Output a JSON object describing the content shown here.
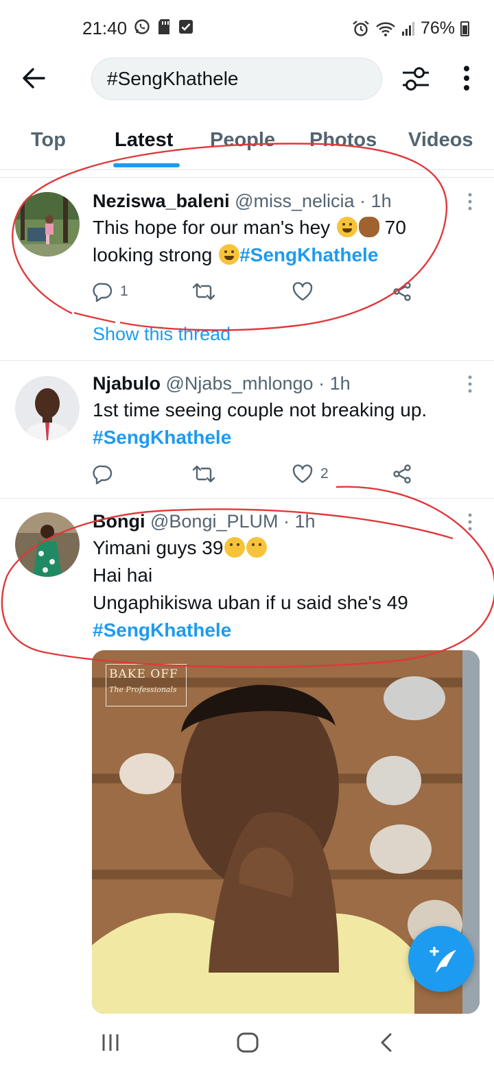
{
  "status_bar": {
    "time": "21:40",
    "battery": "76%",
    "left_icons": [
      "whatsapp-icon",
      "sd-card-icon",
      "check-square-icon"
    ],
    "right_icons": [
      "alarm-icon",
      "wifi-icon",
      "signal-icon",
      "battery-icon"
    ]
  },
  "header": {
    "search_query": "#SengKhathele",
    "back_icon": "arrow-left-icon",
    "filter_icon": "sliders-icon",
    "more_icon": "more-vertical-icon"
  },
  "tabs": [
    {
      "label": "Top",
      "active": false
    },
    {
      "label": "Latest",
      "active": true
    },
    {
      "label": "People",
      "active": false
    },
    {
      "label": "Photos",
      "active": false
    },
    {
      "label": "Videos",
      "active": false
    }
  ],
  "tweets": [
    {
      "name": "Neziswa_baleni",
      "handle": "@miss_nelicia",
      "dot": "·",
      "time": "1h",
      "line1": "This hope for our man's hey ",
      "line1_tail": " 70",
      "line2": "looking strong ",
      "hashtag": "#SengKhathele",
      "reply_count": "1",
      "like_count": "",
      "show_thread": "Show this thread"
    },
    {
      "name": "Njabulo",
      "handle": "@Njabs_mhlongo",
      "dot": "·",
      "time": "1h",
      "line1": "1st time seeing couple not breaking up.",
      "hashtag": "#SengKhathele",
      "reply_count": "",
      "like_count": "2"
    },
    {
      "name": "Bongi",
      "handle": "@Bongi_PLUM",
      "dot": "·",
      "time": "1h",
      "line1": "Yimani guys 39",
      "line2": "Hai hai",
      "line3": "Ungaphikiswa uban if u said she's 49",
      "hashtag": "#SengKhathele",
      "media_logo_line1": "BAKE OFF",
      "media_logo_line2": "The Professionals"
    }
  ],
  "fab_icon": "compose-tweet-icon",
  "nav_bar": [
    "recents-icon",
    "home-icon",
    "back-icon"
  ],
  "colors": {
    "accent": "#1d9bf0",
    "text_primary": "#0f1419",
    "text_secondary": "#536471",
    "annotation": "#e0383a"
  }
}
